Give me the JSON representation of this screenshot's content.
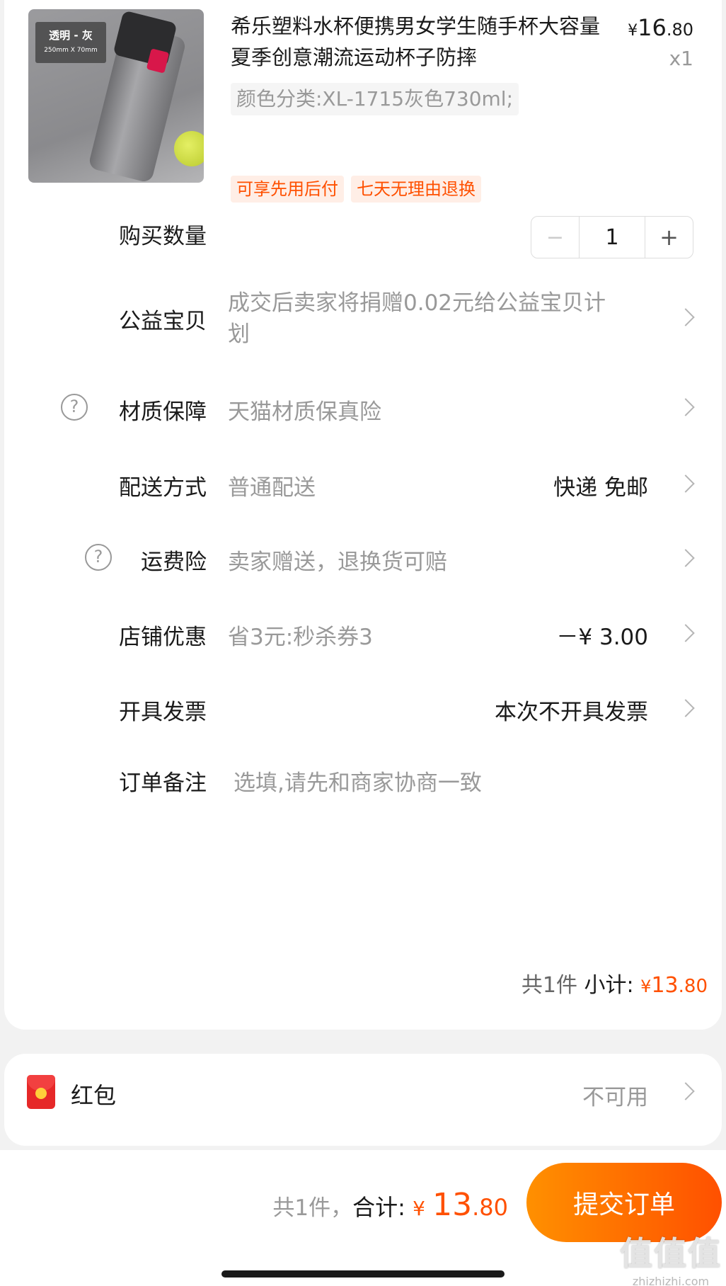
{
  "product": {
    "title": "希乐塑料水杯便携男女学生随手杯大容量夏季创意潮流运动杯子防摔",
    "price_symbol": "¥",
    "price_int": "16",
    "price_dec": ".80",
    "quantity_label": "x1",
    "sku": "颜色分类:XL-1715灰色730ml;",
    "image_tag_line1": "透明 - 灰",
    "image_tag_line2": "250mm X 70mm",
    "badges": [
      "可享先用后付",
      "七天无理由退换"
    ]
  },
  "rows": {
    "quantity": {
      "label": "购买数量",
      "value": "1",
      "minus": "−",
      "plus": "+"
    },
    "charity": {
      "label": "公益宝贝",
      "value": "成交后卖家将捐赠0.02元给公益宝贝计划"
    },
    "material": {
      "label": "材质保障",
      "value": "天猫材质保真险",
      "icon": "?"
    },
    "delivery": {
      "label": "配送方式",
      "value": "普通配送",
      "right": "快递 免邮"
    },
    "shipping_insurance": {
      "label": "运费险",
      "value": "卖家赠送，退换货可赔",
      "icon": "?"
    },
    "store_discount": {
      "label": "店铺优惠",
      "value": "省3元:秒杀券3",
      "right": "－¥ 3.00"
    },
    "invoice": {
      "label": "开具发票",
      "right": "本次不开具发票"
    },
    "remark": {
      "label": "订单备注",
      "placeholder": "选填,请先和商家协商一致"
    }
  },
  "subtotal": {
    "count": "共1件",
    "label": "小计:",
    "symbol": "¥",
    "int": "13",
    "dec": ".80"
  },
  "hongbao": {
    "label": "红包",
    "value": "不可用"
  },
  "footer": {
    "count": "共1件，",
    "label": "合计:",
    "symbol": "¥",
    "int": "13",
    "dec": ".80",
    "submit_label": "提交订单",
    "watermark": "值值值",
    "watermark_url": "zhizhizhi.com"
  },
  "colors": {
    "accent": "#ff5000",
    "accent_start": "#ff9000",
    "muted": "#999999"
  }
}
